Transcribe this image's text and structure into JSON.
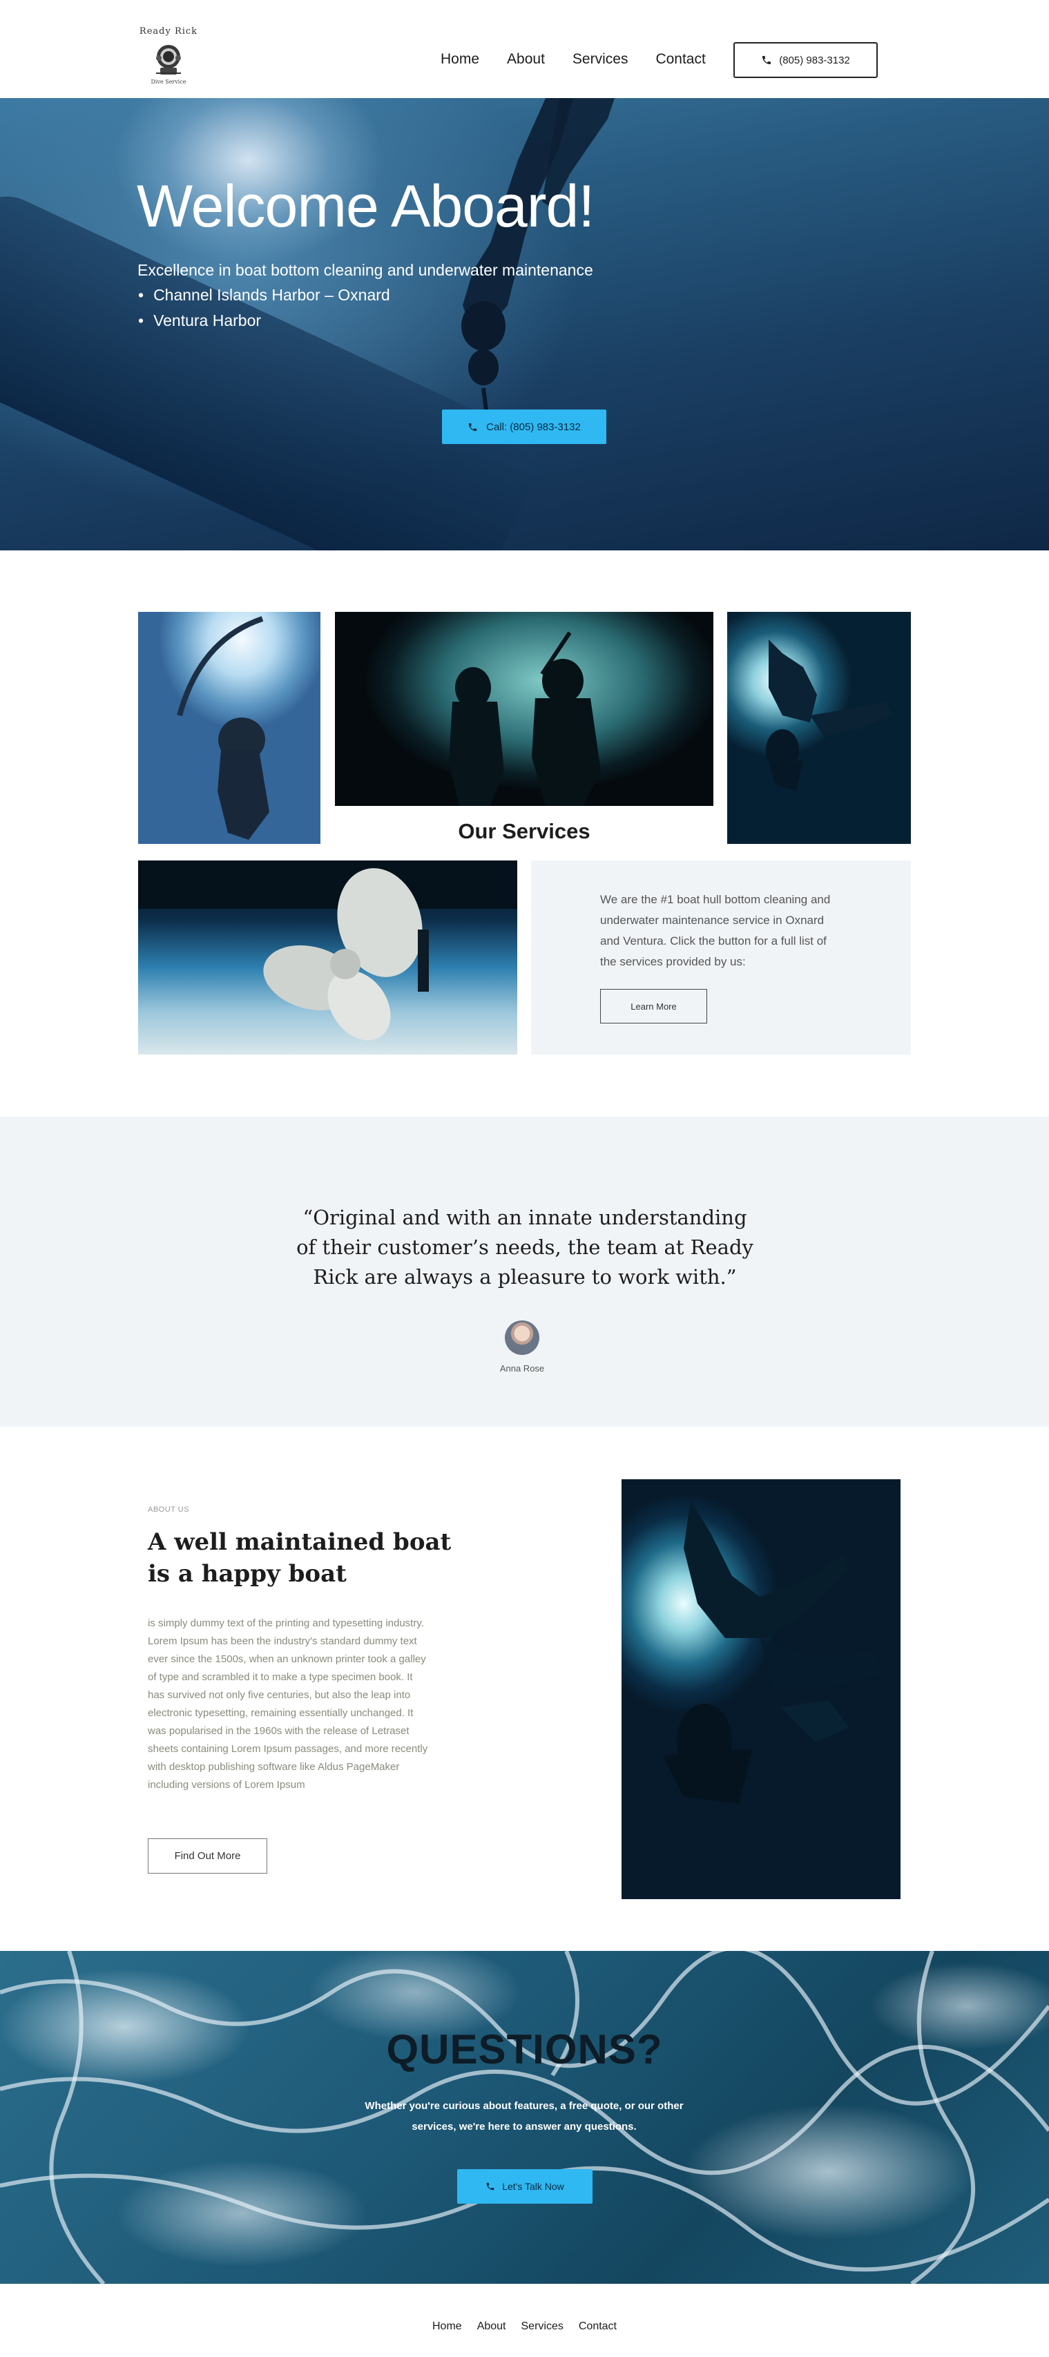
{
  "header": {
    "logo": {
      "top_text": "Ready Rick",
      "bottom_text": "Dive Service"
    },
    "nav": [
      {
        "label": "Home"
      },
      {
        "label": "About"
      },
      {
        "label": "Services"
      },
      {
        "label": "Contact"
      }
    ],
    "phone_button": {
      "label": "(805) 983-3132",
      "icon": "phone-icon"
    }
  },
  "hero": {
    "title": "Welcome Aboard!",
    "subtitle": "Excellence in boat bottom cleaning and underwater maintenance",
    "locations": [
      "Channel Islands Harbor – Oxnard",
      "Ventura Harbor"
    ],
    "call_button": {
      "label": "Call: (805) 983-3132",
      "icon": "phone-icon"
    }
  },
  "services": {
    "title": "Our Services",
    "description": "We are the #1 boat hull bottom cleaning and underwater maintenance service in Oxnard and Ventura. Click the button for a full list of the services provided by us:",
    "button": "Learn More"
  },
  "testimonial": {
    "quote": "“Original and with an innate understanding of their customer’s needs, the team at Ready Rick are always a pleasure to work with.”",
    "author": "Anna Rose"
  },
  "about": {
    "label": "ABOUT US",
    "title": "A well maintained boat is a happy boat",
    "body": "is simply dummy text of the printing and typesetting industry. Lorem Ipsum has been the industry's standard dummy text ever since the 1500s, when an unknown printer took a galley of type and scrambled it to make a type specimen book. It has survived not only five centuries, but also the leap into electronic typesetting, remaining essentially unchanged. It was popularised in the 1960s with the release of Letraset sheets containing Lorem Ipsum passages, and more recently with desktop publishing software like Aldus PageMaker including versions of Lorem Ipsum",
    "button": "Find Out More"
  },
  "questions": {
    "title": "QUESTIONS?",
    "text": "Whether you're curious about features, a free quote, or our other services, we're here to answer any questions.",
    "button": {
      "label": "Let's Talk Now",
      "icon": "phone-icon"
    }
  },
  "footer": {
    "nav": [
      {
        "label": "Home"
      },
      {
        "label": "About"
      },
      {
        "label": "Services"
      },
      {
        "label": "Contact"
      }
    ]
  },
  "colors": {
    "accent": "#2fb8f2",
    "light_section": "#f1f4f6",
    "text_dark": "#1d1d1d",
    "text_muted": "#8a8a7c"
  }
}
